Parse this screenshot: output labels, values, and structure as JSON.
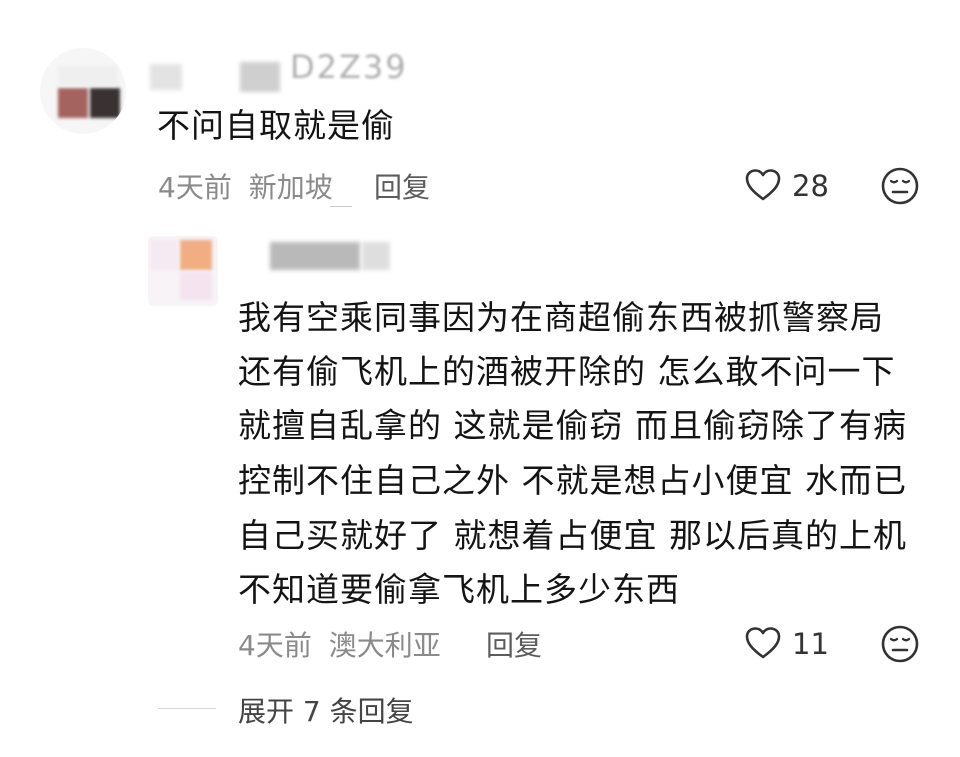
{
  "comment": {
    "username_fragment": "D2Z39",
    "text": "不问自取就是偷",
    "meta_time": "4天前",
    "meta_location": "新加坡",
    "reply_label": "回复",
    "like_count": "28"
  },
  "reply": {
    "text_lines": [
      "我有空乘同事因为在商超偷东西被抓警察局",
      "还有偷飞机上的酒被开除的 怎么敢不问一下",
      "就擅自乱拿的 这就是偷窃 而且偷窃除了有病",
      "控制不住自己之外 不就是想占小便宜 水而已",
      "自己买就好了 就想着占便宜 那以后真的上机",
      "不知道要偷拿飞机上多少东西"
    ],
    "meta_time": "4天前",
    "meta_location": "澳大利亚",
    "reply_label": "回复",
    "like_count": "11"
  },
  "expand_label": "展开 7 条回复",
  "icons": {
    "like": "heart-outline-icon",
    "dislike": "neutral-face-icon"
  },
  "colors": {
    "text": "#141414",
    "meta": "#8a8a8a",
    "icon": "#333333"
  }
}
